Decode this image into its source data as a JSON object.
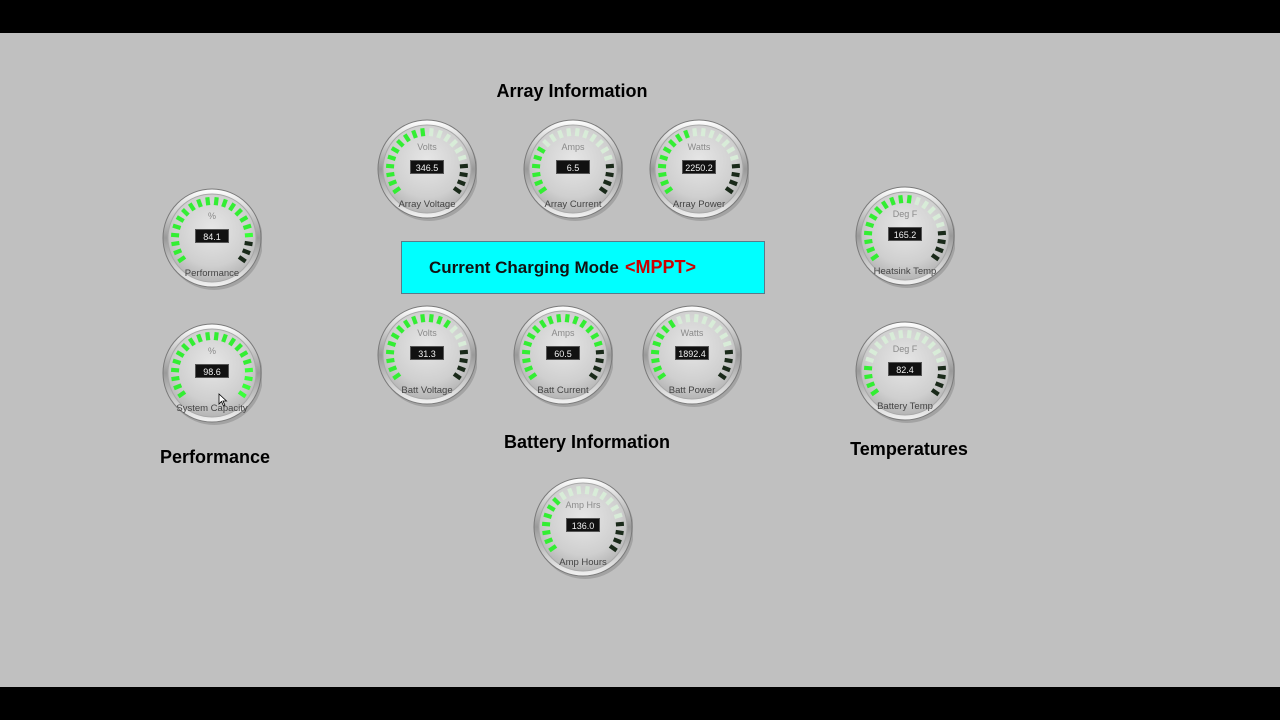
{
  "sections": {
    "array": "Array Information",
    "battery": "Battery Information",
    "performance": "Performance",
    "temperatures": "Temperatures"
  },
  "mode": {
    "label": "Current Charging Mode",
    "value": "<MPPT>"
  },
  "colors": {
    "panel": "#c0c0c0",
    "mode_box": "#00ffff",
    "mode_value": "#cc0000",
    "segment_lit": "#33ee33",
    "segment_dim": "#d8ecd8",
    "segment_dark": "#1a2a1a"
  },
  "gauges": [
    {
      "id": "performance",
      "unit": "%",
      "value": "84.1",
      "label": "Performance",
      "level": 0.841
    },
    {
      "id": "system-capacity",
      "unit": "%",
      "value": "98.6",
      "label": "System Capacity",
      "level": 0.986
    },
    {
      "id": "array-voltage",
      "unit": "Volts",
      "value": "346.5",
      "label": "Array Voltage",
      "level": 0.5
    },
    {
      "id": "array-current",
      "unit": "Amps",
      "value": "6.5",
      "label": "Array Current",
      "level": 0.28
    },
    {
      "id": "array-power",
      "unit": "Watts",
      "value": "2250.2",
      "label": "Array Power",
      "level": 0.45
    },
    {
      "id": "batt-voltage",
      "unit": "Volts",
      "value": "31.3",
      "label": "Batt Voltage",
      "level": 0.65
    },
    {
      "id": "batt-current",
      "unit": "Amps",
      "value": "60.5",
      "label": "Batt Current",
      "level": 0.78
    },
    {
      "id": "batt-power",
      "unit": "Watts",
      "value": "1892.4",
      "label": "Batt Power",
      "level": 0.4
    },
    {
      "id": "amp-hours",
      "unit": "Amp Hrs",
      "value": "136.0",
      "label": "Amp Hours",
      "level": 0.35
    },
    {
      "id": "heatsink-temp",
      "unit": "Deg F",
      "value": "165.2",
      "label": "Heatsink Temp",
      "level": 0.55
    },
    {
      "id": "battery-temp",
      "unit": "Deg F",
      "value": "82.4",
      "label": "Battery Temp",
      "level": 0.2
    }
  ]
}
